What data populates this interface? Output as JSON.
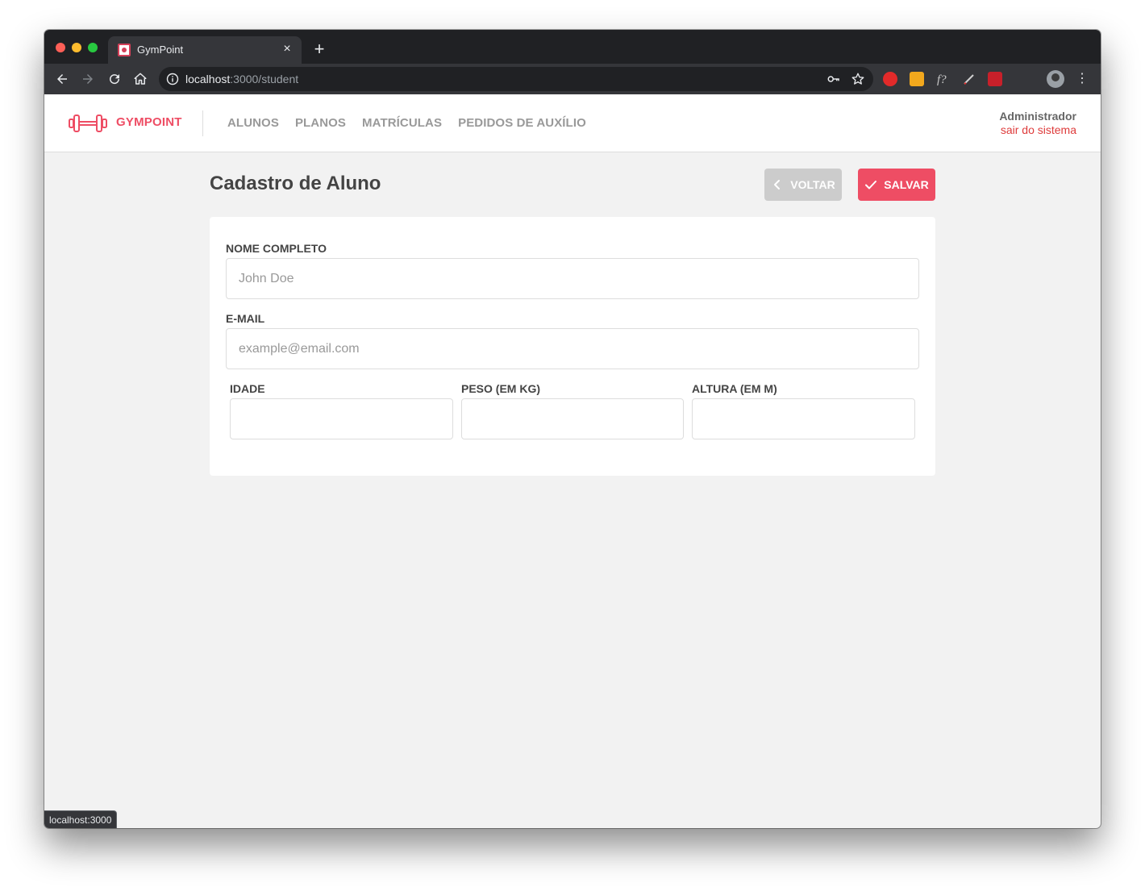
{
  "browser": {
    "tab_title": "GymPoint",
    "tab_close_glyph": "×",
    "new_tab_glyph": "+",
    "url_host": "localhost",
    "url_path": ":3000/student",
    "menu_glyph": "⋮",
    "status_url": "localhost:3000",
    "icons": [
      "back-icon",
      "forward-icon",
      "reload-icon",
      "home-icon",
      "info-icon",
      "key-icon",
      "star-icon",
      "profile-avatar",
      "menu-icon"
    ]
  },
  "header": {
    "brand": "GYMPOINT",
    "nav": [
      {
        "label": "ALUNOS"
      },
      {
        "label": "PLANOS"
      },
      {
        "label": "MATRÍCULAS"
      },
      {
        "label": "PEDIDOS DE AUXÍLIO"
      }
    ],
    "user_name": "Administrador",
    "logout_label": "sair do sistema"
  },
  "page": {
    "title": "Cadastro de Aluno",
    "back_label": "VOLTAR",
    "save_label": "SALVAR"
  },
  "form": {
    "name": {
      "label": "NOME COMPLETO",
      "placeholder": "John Doe",
      "value": ""
    },
    "email": {
      "label": "E-MAIL",
      "placeholder": "example@email.com",
      "value": ""
    },
    "age": {
      "label": "IDADE",
      "placeholder": "",
      "value": ""
    },
    "weight": {
      "label": "PESO (EM KG)",
      "placeholder": "",
      "value": ""
    },
    "height": {
      "label": "ALTURA (EM M)",
      "placeholder": "",
      "value": ""
    }
  },
  "colors": {
    "brand": "#ee4d64",
    "logout": "#de3b3b",
    "back_button": "#cccccc",
    "page_background": "#f2f2f2"
  }
}
